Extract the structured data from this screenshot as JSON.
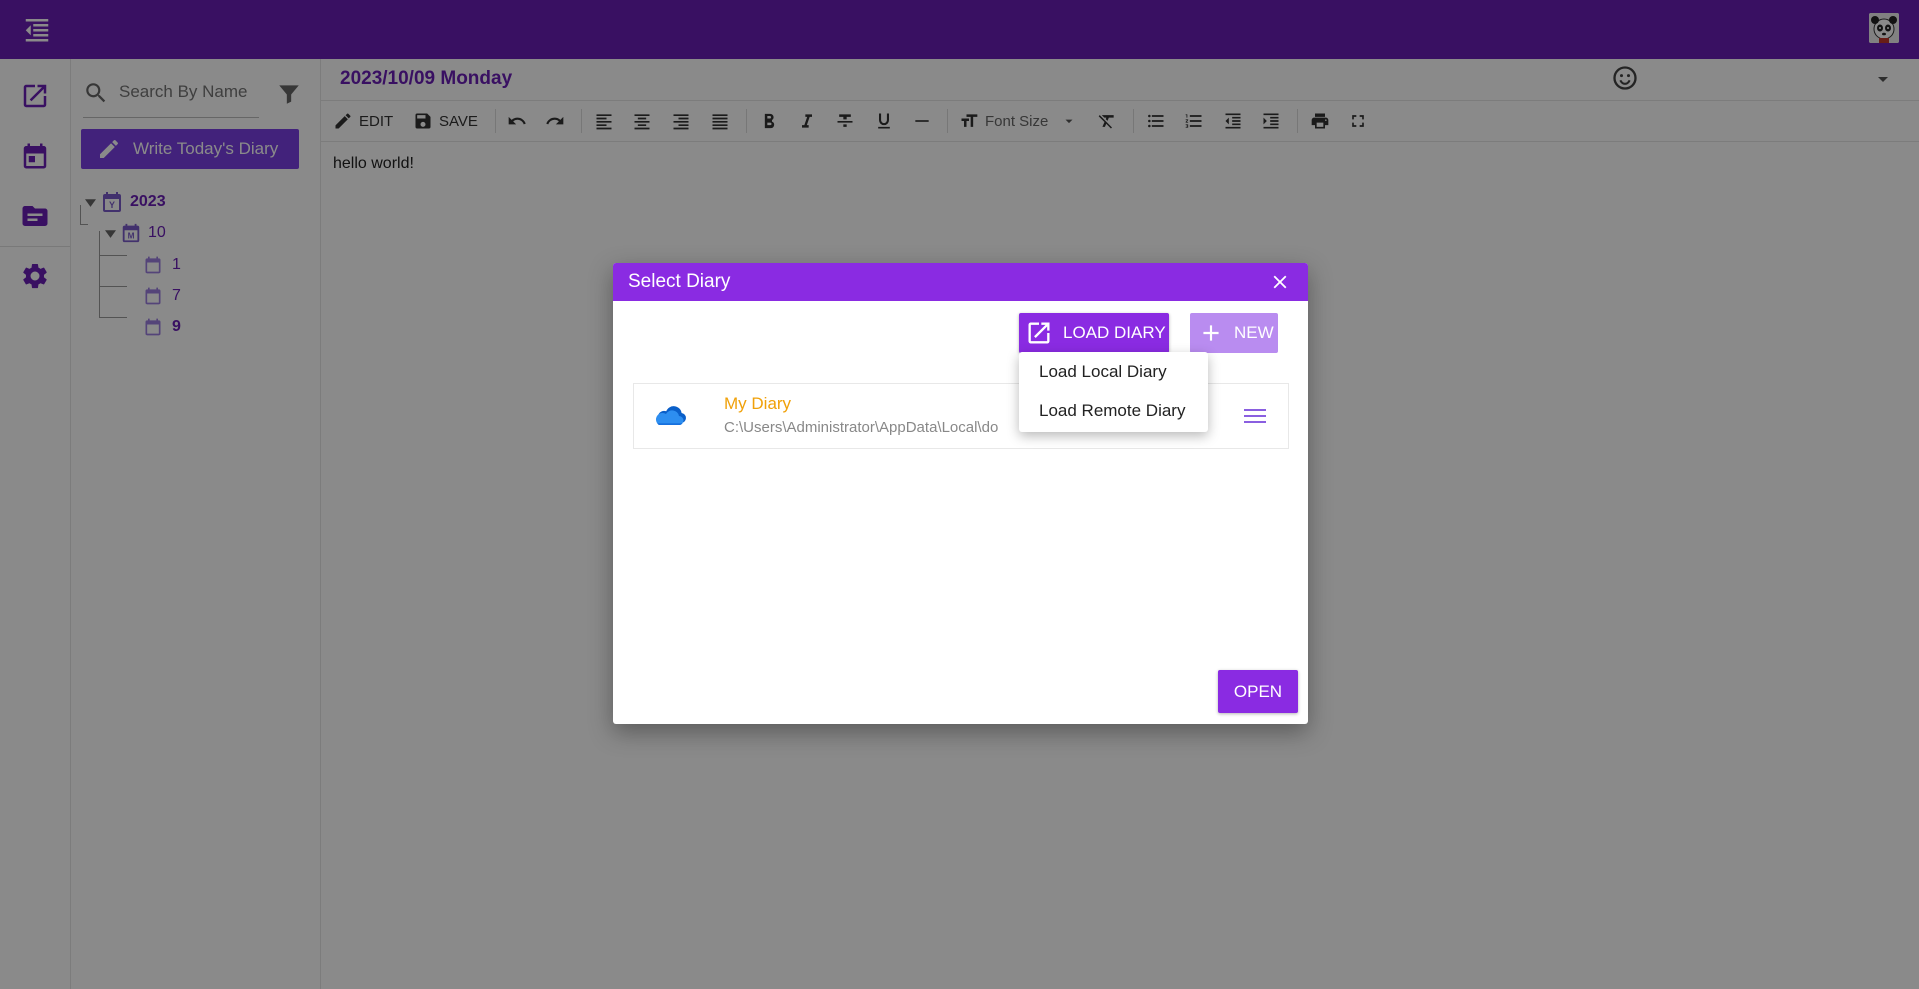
{
  "app": {
    "theme_color": "#6a1fb5",
    "accent_color": "#8a2be2"
  },
  "sidebar": {
    "search_placeholder": "Search By Name",
    "write_button_label": "Write Today's Diary",
    "tree": {
      "year": "2023",
      "month": "10",
      "days": [
        "1",
        "7",
        "9"
      ]
    }
  },
  "editor": {
    "date_title": "2023/10/09 Monday",
    "toolbar": {
      "edit_label": "EDIT",
      "save_label": "SAVE",
      "font_size_label": "Font Size"
    },
    "content": "hello world!"
  },
  "dialog": {
    "title": "Select Diary",
    "load_button_label": "LOAD DIARY",
    "new_button_label": "NEW",
    "diaries": [
      {
        "name": "My Diary",
        "path": "C:\\Users\\Administrator\\AppData\\Local\\do"
      }
    ],
    "open_button_label": "OPEN",
    "load_menu": {
      "items": [
        "Load Local Diary",
        "Load Remote Diary"
      ]
    }
  }
}
